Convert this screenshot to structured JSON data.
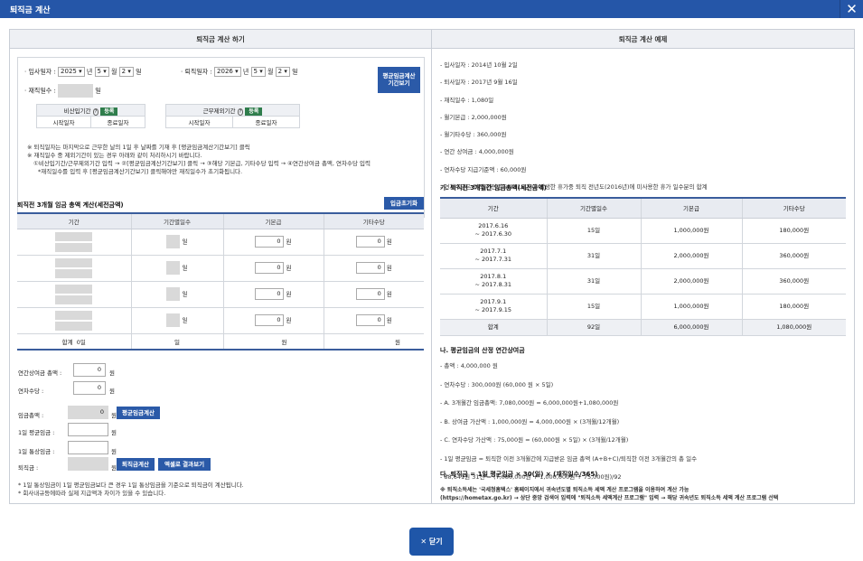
{
  "window": {
    "title": "퇴직금 계산",
    "close_icon": "close-icon"
  },
  "left": {
    "header": "퇴직금 계산 하기",
    "entry_label": "입사일자 :",
    "entry_year": "2025",
    "entry_month": "5",
    "entry_day": "2",
    "unit_year": "년",
    "unit_month": "월",
    "unit_day": "일",
    "exit_label": "퇴직일자 :",
    "exit_year": "2026",
    "exit_month": "5",
    "exit_day": "2",
    "workdays_label": "재직일수 :",
    "workdays_unit": "일",
    "avg_period_btn": "평균임금계산\n기간보기",
    "excl_label": "비산입기간",
    "excl_reg": "등록",
    "start_date": "시작일자",
    "end_date": "종료일자",
    "excl2_label": "근무제외기간",
    "excl2_reg": "등록",
    "notes": [
      "※ 퇴직일자는 마지막으로 근무한 날의 1일 후 날짜를 기재 후 [평균임금계산기간보기] 클릭",
      "※ 재직일수 중 제외기간이 있는 경우 아래와 같이 처리하시기 바랍니다.",
      "①비산입기간/근무제외기간 입력 → ②[평균임금계산기간보기] 클릭 → ③해당 기본급, 기타수당 입력 → ④연간상여금 총액, 연차수당 입력",
      "*재직일수를 입력 후 [평균임금계산기간보기] 클릭해야만 재직일수가 초기화됩니다."
    ],
    "wage_title": "퇴직전 3개월 임금 총액 계산(세전금액)",
    "reset_btn": "입금초기화",
    "cols": [
      "기간",
      "기간별일수",
      "기본급",
      "기타수당"
    ],
    "rows": [
      {
        "days_unit": "일",
        "base": "0",
        "base_unit": "원",
        "other": "0",
        "other_unit": "원"
      },
      {
        "days_unit": "일",
        "base": "0",
        "base_unit": "원",
        "other": "0",
        "other_unit": "원"
      },
      {
        "days_unit": "일",
        "base": "0",
        "base_unit": "원",
        "other": "0",
        "other_unit": "원"
      },
      {
        "days_unit": "일",
        "base": "0",
        "base_unit": "원",
        "other": "0",
        "other_unit": "원"
      }
    ],
    "total": {
      "label": "합계",
      "days": "0일",
      "days2": "일",
      "base": "원",
      "other": "원"
    },
    "bonus_label": "연간상여금 총액 :",
    "bonus_val": "0",
    "bonus_unit": "원",
    "leave_label": "연차수당 :",
    "leave_val": "0",
    "leave_unit": "원",
    "wage_total_label": "임금총액 :",
    "wage_total_val": "0",
    "wage_total_unit": "원",
    "avg_calc_btn": "평균임금계산",
    "avg_day_label": "1일 평균임금 :",
    "avg_day_unit": "원",
    "normal_label": "1일 통상임금 :",
    "normal_unit": "원",
    "sev_label": "퇴직금 :",
    "sev_unit": "원",
    "sev_calc_btn": "퇴직금계산",
    "excel_btn": "엑셀로 결과보기",
    "foot": [
      "* 1일 통상임금이 1일 평균임금보다 큰 경우 1일 통상임금을 기준으로 퇴직금이 계산됩니다.",
      "* 회사내규등에따라 실제 지급액과 차이가 있을 수 있습니다."
    ]
  },
  "right": {
    "header": "퇴직금 계산 예제",
    "info": [
      "- 입사일자 : 2014년 10월 2일",
      "- 퇴사일자 : 2017년 9월 16일",
      "- 재직일수 : 1,080일",
      "- 월기본급 : 2,000,000원",
      "- 월기타수당 : 360,000원",
      "- 연간 상여금 : 4,000,000원",
      "- 연차수당 지급기준액 : 60,000원",
      "- 연차수당은 퇴직 전전년도(2015년)에 발생한 휴가중 퇴직 전년도(2016년)에 미사용한 휴가 일수분의 합계"
    ],
    "sec_a": "가. 퇴직전 3개월간 임금총액(세전금액)",
    "cols": [
      "기간",
      "기간별일수",
      "기본급",
      "기타수당"
    ],
    "rows": [
      {
        "p": "2017.6.16\n~ 2017.6.30",
        "d": "15일",
        "b": "1,000,000원",
        "o": "180,000원"
      },
      {
        "p": "2017.7.1\n~ 2017.7.31",
        "d": "31일",
        "b": "2,000,000원",
        "o": "360,000원"
      },
      {
        "p": "2017.8.1\n~ 2017.8.31",
        "d": "31일",
        "b": "2,000,000원",
        "o": "360,000원"
      },
      {
        "p": "2017.9.1\n~ 2017.9.15",
        "d": "15일",
        "b": "1,000,000원",
        "o": "180,000원"
      }
    ],
    "total": {
      "p": "합계",
      "d": "92일",
      "b": "6,000,000원",
      "o": "1,080,000원"
    },
    "sec_b": "나. 평균임금의 산정 연간상여금",
    "calc": [
      "- 총액 : 4,000,000 원",
      "- 연차수당 : 300,000원 (60,000 원 × 5일)",
      "- A. 3개월간 임금총액: 7,080,000원 = 6,000,000원+1,080,000원",
      "- B. 상여금 가산액 : 1,000,000원 = 4,000,000원 × (3개월/12개월)",
      "- C. 연차수당 가산액 : 75,000원 = (60,000원 × 5일) × (3개월/12개월)",
      "- 1일 평균임금 = 퇴직한 이전 3개월간에 지급받은 임금 총액 (A+B+C)/퇴직한 이전 3개월간의 총 일수",
      "- 88,641원 31전 = (7,080,000원 + 1,000,000원 + 75,000원)/92"
    ],
    "sec_c": "다. 퇴직금 = 1일 평균임금 × 30(일) × (재직일수/365)",
    "note1": "※ 퇴직소득세는 '국세청홈택스' 홈페이지에서 귀속년도별 퇴직소득 세액 계산 프로그램을 이용하여 계산 가능",
    "note2": "(https://hometax.go.kr) → 상단 중앙 검색어 입력에 \"퇴직소득 세액계산 프로그램\" 입력 → 해당 귀속년도 퇴직소득 세액 계산 프로그램 선택"
  },
  "close_btn": "닫기"
}
